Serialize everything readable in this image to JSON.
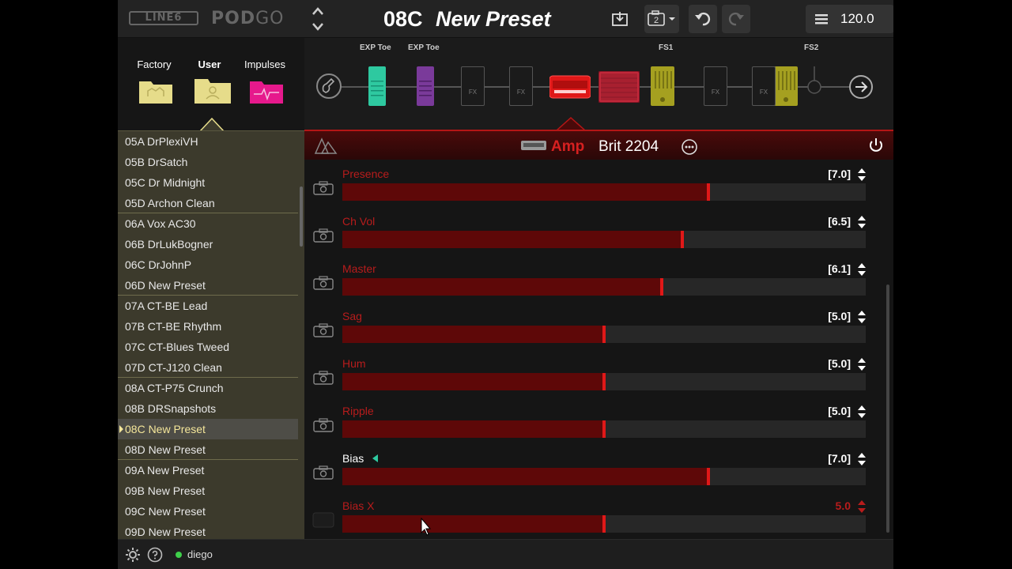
{
  "header": {
    "logo_brand": "LINE6",
    "logo_product": "POD",
    "logo_product_suffix": "GO",
    "preset_number": "08C",
    "preset_name": "New Preset",
    "snapshot_number": "2",
    "tempo": "120.0"
  },
  "library": {
    "tabs": [
      "Factory",
      "User",
      "Impulses"
    ],
    "active_tab": "User",
    "items": [
      {
        "label": "05A DrPlexiVH"
      },
      {
        "label": "05B DrSatch"
      },
      {
        "label": "05C Dr Midnight"
      },
      {
        "label": "05D Archon Clean"
      },
      {
        "label": "06A Vox AC30"
      },
      {
        "label": "06B DrLukBogner"
      },
      {
        "label": "06C DrJohnP"
      },
      {
        "label": "06D New Preset"
      },
      {
        "label": "07A CT-BE Lead"
      },
      {
        "label": "07B CT-BE Rhythm"
      },
      {
        "label": "07C CT-Blues Tweed"
      },
      {
        "label": "07D CT-J120 Clean"
      },
      {
        "label": "08A CT-P75 Crunch"
      },
      {
        "label": "08B DRSnapshots"
      },
      {
        "label": "08C New Preset"
      },
      {
        "label": "08D New Preset"
      },
      {
        "label": "09A New Preset"
      },
      {
        "label": "09B New Preset"
      },
      {
        "label": "09C New Preset"
      },
      {
        "label": "09D New Preset"
      }
    ],
    "selected": "08C New Preset"
  },
  "chain": {
    "labels": {
      "exp1": "EXP Toe",
      "exp2": "EXP Toe",
      "fs1": "FS1",
      "fs2": "FS2"
    },
    "fx_label": "FX"
  },
  "editor": {
    "block_type": "Amp",
    "model": "Brit 2204",
    "params": [
      {
        "name": "Presence",
        "value": "[7.0]",
        "level": 0.7
      },
      {
        "name": "Ch Vol",
        "value": "[6.5]",
        "level": 0.65
      },
      {
        "name": "Master",
        "value": "[6.1]",
        "level": 0.61
      },
      {
        "name": "Sag",
        "value": "[5.0]",
        "level": 0.5
      },
      {
        "name": "Hum",
        "value": "[5.0]",
        "level": 0.5
      },
      {
        "name": "Ripple",
        "value": "[5.0]",
        "level": 0.5
      },
      {
        "name": "Bias",
        "value": "[7.0]",
        "level": 0.7
      },
      {
        "name": "Bias X",
        "value": "5.0",
        "level": 0.5
      }
    ]
  },
  "footer": {
    "user": "diego"
  },
  "colors": {
    "accent_red": "#d62020",
    "list_bg": "#3c3a2c",
    "selected_text": "#f4e69a",
    "online": "#3ecf4a"
  }
}
